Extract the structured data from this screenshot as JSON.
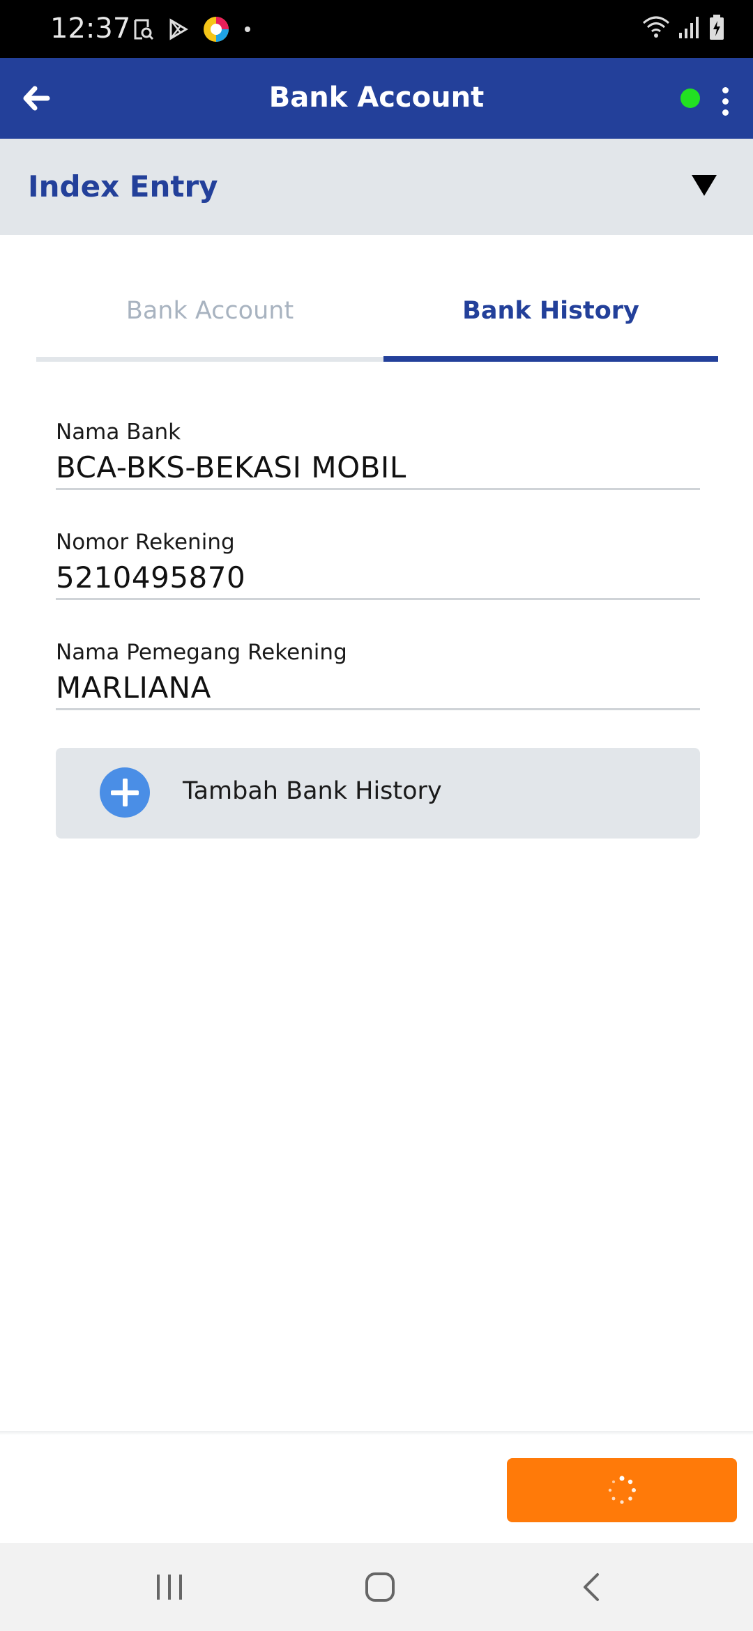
{
  "status_bar": {
    "time": "12:37",
    "left_icons": [
      "screenshot-icon",
      "play-store-icon",
      "app-icon",
      "notification-dot-icon"
    ],
    "right_icons": [
      "wifi-icon",
      "signal-icon",
      "battery-charging-icon"
    ]
  },
  "app_bar": {
    "title": "Bank Account",
    "status_color": "#22e022",
    "brand_color": "#23409a"
  },
  "index_entry": {
    "title": "Index Entry"
  },
  "tabs": [
    {
      "label": "Bank Account",
      "active": false
    },
    {
      "label": "Bank History",
      "active": true
    }
  ],
  "fields": {
    "nama_bank": {
      "label": "Nama Bank",
      "value": "BCA-BKS-BEKASI MOBIL"
    },
    "nomor_rekening": {
      "label": "Nomor Rekening",
      "value": "5210495870"
    },
    "nama_pemegang": {
      "label": "Nama Pemegang Rekening",
      "value": "MARLIANA"
    }
  },
  "add_button": {
    "label": "Tambah Bank History"
  },
  "submit_button": {
    "color": "#ff7a09",
    "state": "loading"
  }
}
